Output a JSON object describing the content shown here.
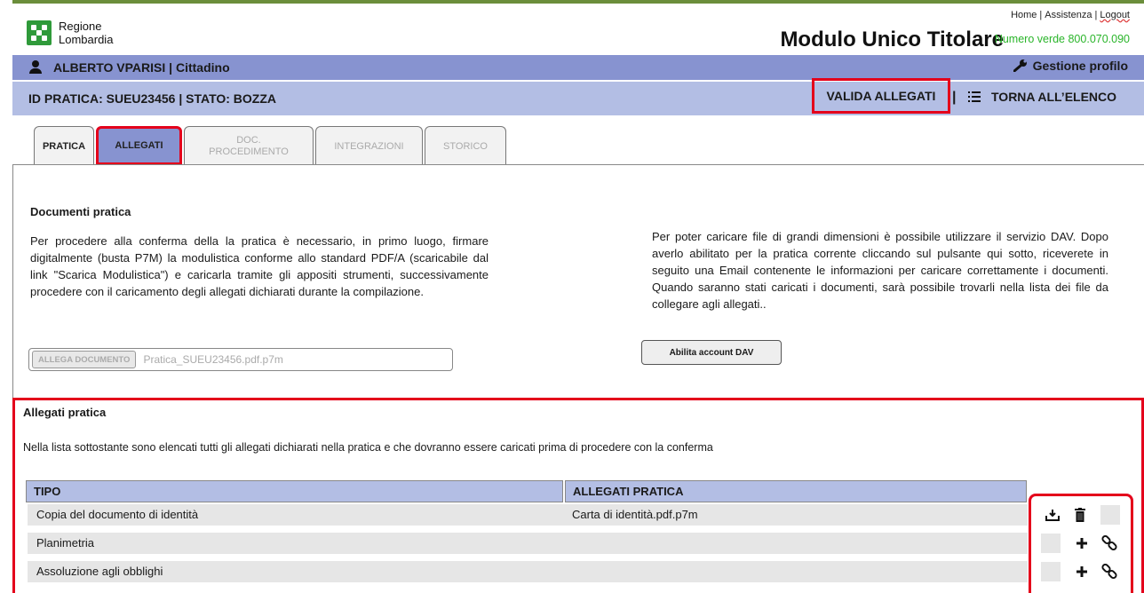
{
  "header": {
    "logo_line1": "Regione",
    "logo_line2": "Lombardia",
    "title": "Modulo Unico Titolare",
    "links": [
      "Home",
      "Assistenza",
      "Logout"
    ],
    "numero_verde": "Numero verde 800.070.090"
  },
  "userbar": {
    "user": "ALBERTO VPARISI | Cittadino",
    "profile_link": "Gestione profilo"
  },
  "pratica_bar": {
    "id_stato": "ID PRATICA: SUEU23456  | STATO: BOZZA",
    "valida": "VALIDA ALLEGATI",
    "separator": "|",
    "torna": "TORNA ALL’ELENCO"
  },
  "tabs": [
    {
      "label": "PRATICA",
      "state": "normal"
    },
    {
      "label": "ALLEGATI",
      "state": "active"
    },
    {
      "label": "DOC.\nPROCEDIMENTO",
      "state": "disabled"
    },
    {
      "label": "INTEGRAZIONI",
      "state": "disabled"
    },
    {
      "label": "STORICO",
      "state": "disabled"
    }
  ],
  "documenti": {
    "heading": "Documenti pratica",
    "text_left": "Per procedere alla conferma della la pratica è necessario, in primo luogo, firmare digitalmente (busta P7M) la modulistica conforme allo standard PDF/A (scaricabile dal link \"Scarica Modulistica\") e caricarla tramite gli appositi strumenti, successivamente procedere con il caricamento degli allegati dichiarati durante la compilazione.",
    "upload_button": "ALLEGA DOCUMENTO",
    "upload_file": "Pratica_SUEU23456.pdf.p7m",
    "text_right": "Per poter caricare file di grandi dimensioni è possibile utilizzare il servizio DAV. Dopo averlo abilitato per la pratica corrente cliccando sul pulsante qui sotto, riceverete in seguito una Email contenente le informazioni per caricare correttamente i documenti. Quando saranno stati caricati i documenti, sarà possibile trovarli nella lista dei file da collegare agli allegati..",
    "dav_button": "Abilita account DAV"
  },
  "allegati": {
    "heading": "Allegati pratica",
    "description": "Nella lista sottostante sono elencati tutti gli allegati dichiarati nella pratica e che dovranno essere caricati prima di procedere con la conferma",
    "columns": [
      "TIPO",
      "ALLEGATI PRATICA"
    ],
    "rows": [
      {
        "tipo": "Copia del documento di identità",
        "file": "Carta di identità.pdf.p7m",
        "actions": [
          "download-icon",
          "trash-icon",
          "blank"
        ]
      },
      {
        "tipo": "Planimetria",
        "file": "",
        "actions": [
          "blank",
          "plus-icon",
          "link-icon"
        ]
      },
      {
        "tipo": "Assoluzione agli obblighi",
        "file": "",
        "actions": [
          "blank",
          "plus-icon",
          "link-icon"
        ]
      }
    ]
  },
  "colors": {
    "userbar": "#8793d0",
    "praticabar": "#b3bee4",
    "highlight": "#e4001b",
    "numero_verde": "#2ab52a",
    "logo": "#2f9a3a"
  }
}
